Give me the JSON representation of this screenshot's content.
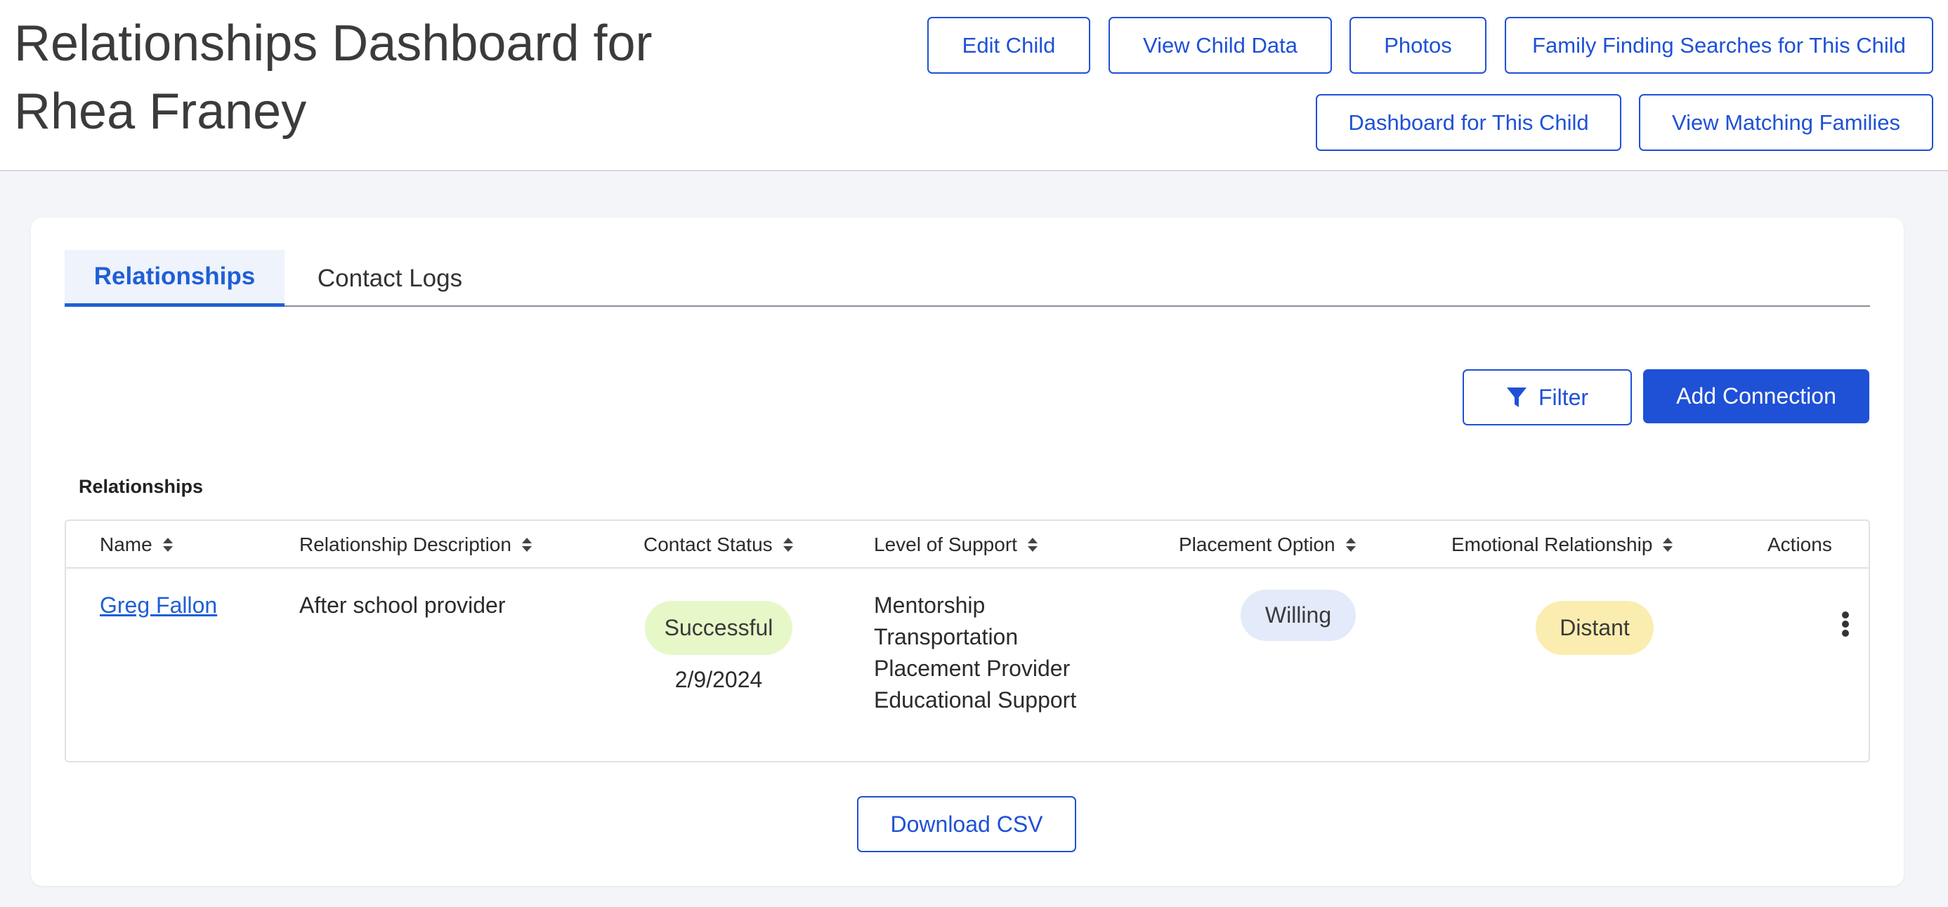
{
  "header": {
    "title_line1": "Relationships Dashboard for",
    "title_line2": "Rhea Franey",
    "buttons": {
      "edit_child": "Edit Child",
      "view_child_data": "View Child Data",
      "photos": "Photos",
      "family_finding": "Family Finding Searches for This Child",
      "dashboard": "Dashboard for This Child",
      "matching_families": "View Matching Families"
    }
  },
  "tabs": {
    "relationships": "Relationships",
    "contact_logs": "Contact Logs"
  },
  "toolbar": {
    "filter": "Filter",
    "add_connection": "Add Connection"
  },
  "section_title": "Relationships",
  "table": {
    "columns": {
      "name": "Name",
      "description": "Relationship Description",
      "contact_status": "Contact Status",
      "level_of_support": "Level of Support",
      "placement_option": "Placement Option",
      "emotional_relationship": "Emotional Relationship",
      "actions": "Actions"
    },
    "rows": [
      {
        "name": "Greg Fallon",
        "description": "After school provider",
        "contact_status": "Successful",
        "contact_date": "2/9/2024",
        "support": [
          "Mentorship",
          "Transportation",
          "Placement Provider",
          "Educational Support"
        ],
        "placement_option": "Willing",
        "emotional_relationship": "Distant"
      }
    ]
  },
  "download_csv": "Download CSV",
  "colors": {
    "primary": "#1f51d6",
    "status_successful_bg": "#e6f8c8",
    "placement_willing_bg": "#e3eaf9",
    "emotional_distant_bg": "#fbedb0"
  }
}
